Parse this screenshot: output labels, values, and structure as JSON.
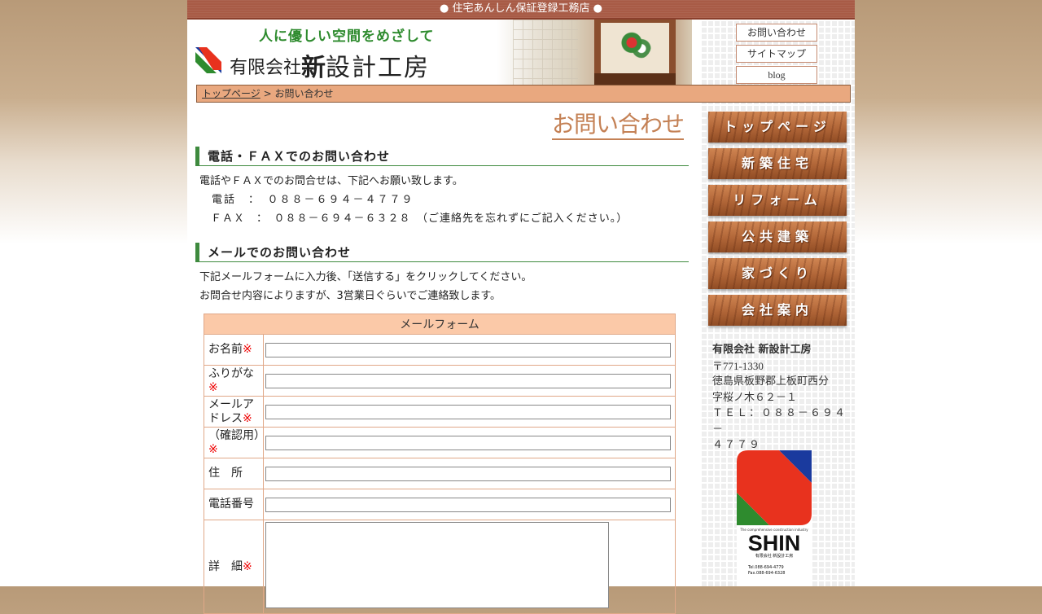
{
  "topbar": {
    "text": "● 住宅あんしん保証登録工務店 ●"
  },
  "header": {
    "tagline": "人に優しい空間をめざして",
    "company_prefix": "有限会社",
    "company_shin": "新",
    "company_rest": "設計工房"
  },
  "mini_links": [
    "お問い合わせ",
    "サイトマップ",
    "blog"
  ],
  "breadcrumb": {
    "home": "トップページ",
    "sep": " > ",
    "current": "お問い合わせ"
  },
  "page_title": "お問い合わせ",
  "section1": {
    "heading": "電話・ＦＡＸでのお問い合わせ",
    "lines": [
      "電話やＦＡＸでのお問合せは、下記へお願い致します。",
      "　電話　：　０８８－６９４－４７７９",
      "　ＦＡＸ　：　０８８－６９４－６３２８　（ご連絡先を忘れずにご記入ください。）"
    ]
  },
  "section2": {
    "heading": "メールでのお問い合わせ",
    "lines": [
      "下記メールフォームに入力後、「送信する」をクリックしてください。",
      "お問合せ内容によりますが、3営業日ぐらいでご連絡致します。"
    ]
  },
  "form": {
    "title": "メールフォーム",
    "required_mark": "※",
    "fields": [
      {
        "label": "お名前",
        "required": true
      },
      {
        "label": "ふりがな",
        "required": true
      },
      {
        "label": "メールアドレス",
        "required": true
      },
      {
        "label": "（確認用）",
        "required": true
      },
      {
        "label": "住　所",
        "required": false
      },
      {
        "label": "電話番号",
        "required": false
      },
      {
        "label": "詳　細",
        "required": true
      }
    ]
  },
  "nav": [
    "トップページ",
    "新築住宅",
    "リフォーム",
    "公共建築",
    "家づくり",
    "会社案内"
  ],
  "address": {
    "name": "有限会社 新設計工房",
    "postal": "〒771-1330",
    "line1": "徳島県板野郡上板町西分",
    "line2": "字桜ノ木６２－１",
    "tel1": "ＴＥＬ：０８８－６９４－",
    "tel2": "４７７９"
  },
  "big_logo": {
    "tagline": "The comprehensive construction industry",
    "wordmark": "SHIN",
    "company": "有限会社 新設計工房",
    "tel": "Tel.088-694-4779",
    "fax": "Fax.088-694-6328"
  },
  "colors": {
    "topbar": "#a85b46",
    "accent_green": "#3e8a3e",
    "title_orange": "#c48155",
    "form_header": "#fbc9a8"
  }
}
